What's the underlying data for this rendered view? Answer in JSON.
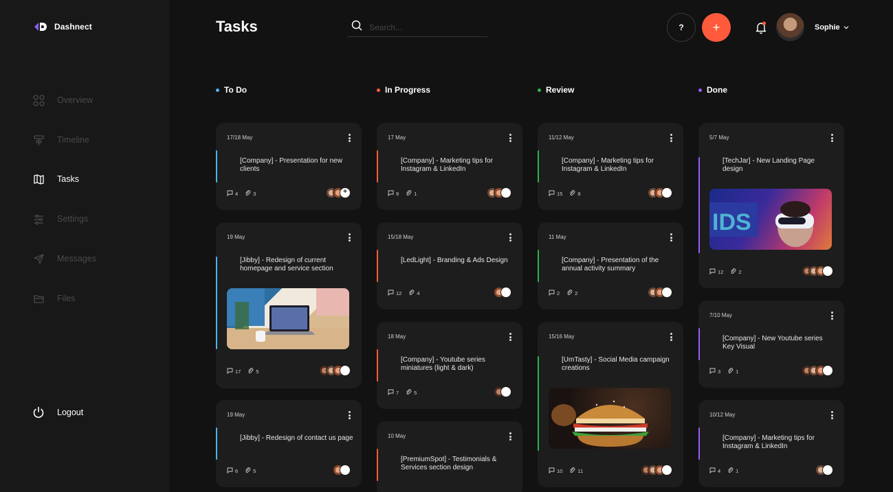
{
  "app": {
    "name": "Dashnect"
  },
  "colors": {
    "todo": "#4fb3e8",
    "in_progress": "#ff5a3c",
    "review": "#2fb34a",
    "done": "#9b5cf6",
    "accent": "#ff5a3c"
  },
  "sidebar": {
    "items": [
      {
        "label": "Overview",
        "icon": "overview-icon"
      },
      {
        "label": "Timeline",
        "icon": "timeline-icon"
      },
      {
        "label": "Tasks",
        "icon": "tasks-icon",
        "active": true
      },
      {
        "label": "Settings",
        "icon": "settings-icon"
      },
      {
        "label": "Messages",
        "icon": "messages-icon"
      },
      {
        "label": "Files",
        "icon": "files-icon"
      }
    ],
    "logout_label": "Logout"
  },
  "header": {
    "title": "Tasks",
    "search_placeholder": "Search...",
    "help_label": "?",
    "add_label": "+",
    "user_name": "Sophie"
  },
  "columns": [
    {
      "title": "To Do",
      "cards": [
        {
          "date": "17/18 May",
          "title": "[Company] - Presentation for new clients",
          "comments": "4",
          "attachments": "3"
        },
        {
          "date": "19 May",
          "title": "[Jibby] - Redesign of current homepage and service section",
          "comments": "17",
          "attachments": "5",
          "image": "laptop-desk-image"
        },
        {
          "date": "19 May",
          "title": "[Jibby] - Redesign of contact us page",
          "comments": "6",
          "attachments": "5"
        }
      ]
    },
    {
      "title": "In Progress",
      "cards": [
        {
          "date": "17 May",
          "title": "[Company] - Marketing tips for Instagram & LinkedIn",
          "comments": "9",
          "attachments": "1"
        },
        {
          "date": "15/18 May",
          "title": "[LedLight] - Branding & Ads Design",
          "comments": "12",
          "attachments": "4"
        },
        {
          "date": "18 May",
          "title": "[Company] - Youtube series miniatures (light & dark)",
          "comments": "7",
          "attachments": "5"
        },
        {
          "date": "10 May",
          "title": "[PremiumSpot] - Testimonials & Services section design"
        }
      ]
    },
    {
      "title": "Review",
      "cards": [
        {
          "date": "11/12 May",
          "title": "[Company] - Marketing tips for Instagram & LinkedIn",
          "comments": "15",
          "attachments": "8"
        },
        {
          "date": "11 May",
          "title": "[Company] - Presentation of the annual activity summary",
          "comments": "2",
          "attachments": "2"
        },
        {
          "date": "15/16 May",
          "title": "[UmTasty] - Social Media campaign creations",
          "comments": "10",
          "attachments": "11",
          "image": "burger-image"
        }
      ]
    },
    {
      "title": "Done",
      "cards": [
        {
          "date": "5/7 May",
          "title": "[TechJar] - New Landing Page design",
          "comments": "12",
          "attachments": "2",
          "image": "vr-headset-image"
        },
        {
          "date": "7/10 May",
          "title": "[Company] - New Youtube series Key Visual",
          "comments": "3",
          "attachments": "1"
        },
        {
          "date": "10/12 May",
          "title": "[Company] - Marketing tips for Instagram & LinkedIn",
          "comments": "4",
          "attachments": "1"
        }
      ]
    }
  ]
}
